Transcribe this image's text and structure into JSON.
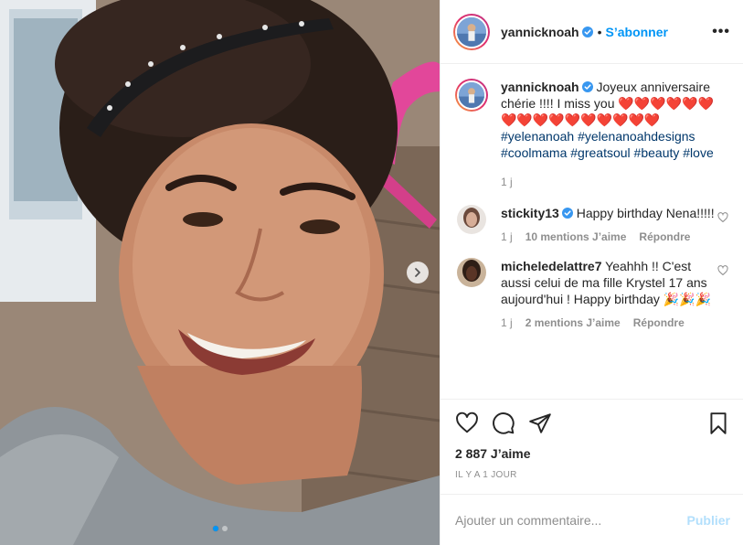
{
  "header": {
    "username": "yannicknoah",
    "separator": "•",
    "follow_label": "S’abonner",
    "more_label": "•••"
  },
  "caption": {
    "username": "yannicknoah",
    "text": "Joyeux anniversaire chérie !!!! I miss you ❤️❤️❤️❤️❤️❤️❤️❤️❤️❤️❤️❤️❤️❤️❤️❤️",
    "hashtags": [
      "#yelenanoah",
      "#yelenanoahdesigns",
      "#coolmama",
      "#greatsoul",
      "#beauty",
      "#love"
    ],
    "time": "1 j"
  },
  "comments": [
    {
      "username": "stickity13",
      "verified": true,
      "text": "Happy birthday Nena!!!!!",
      "time": "1 j",
      "likes": "10 mentions J’aime",
      "reply": "Répondre"
    },
    {
      "username": "micheledelattre7",
      "verified": false,
      "text": "Yeahhh !! C'est aussi celui de ma fille Krystel 17 ans aujourd'hui ! Happy birthday 🎉🎉🎉",
      "time": "1 j",
      "likes": "2 mentions J’aime",
      "reply": "Répondre"
    }
  ],
  "actions": {
    "icons": [
      "heart-icon",
      "comment-icon",
      "share-icon",
      "bookmark-icon"
    ]
  },
  "likes_count": "2 887 J’aime",
  "timestamp": "IL Y A 1 JOUR",
  "comment_box": {
    "placeholder": "Ajouter un commentaire...",
    "publish_label": "Publier"
  },
  "carousel": {
    "total": 2,
    "current": 1
  },
  "colors": {
    "accent": "#0095f6",
    "link": "#00376b",
    "muted": "#8e8e8e",
    "publish_disabled": "#b2dffc",
    "verified": "#3897f0"
  }
}
